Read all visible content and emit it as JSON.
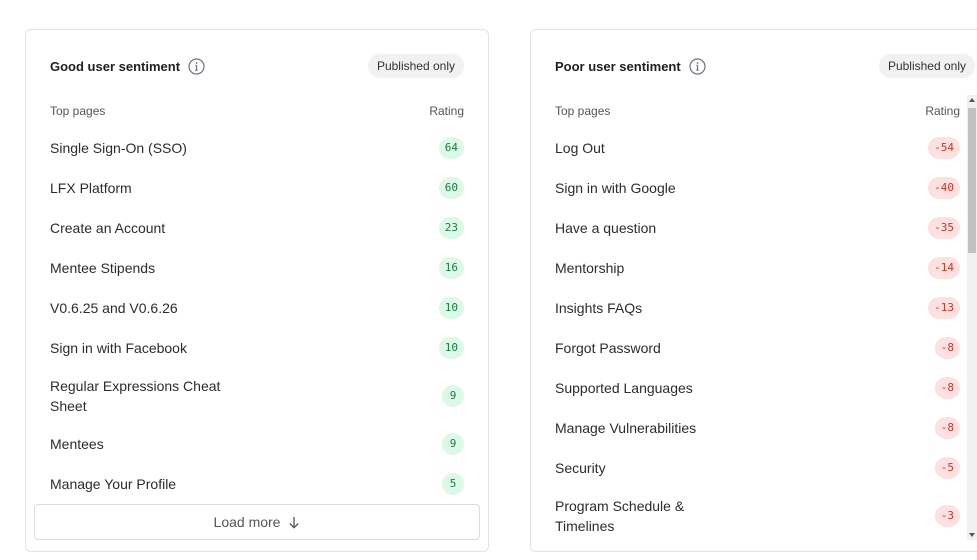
{
  "good": {
    "title": "Good user sentiment",
    "filter": "Published only",
    "col_page": "Top pages",
    "col_rating": "Rating",
    "rows": [
      {
        "label": "Single Sign-On (SSO)",
        "rating": "64"
      },
      {
        "label": "LFX Platform",
        "rating": "60"
      },
      {
        "label": "Create an Account",
        "rating": "23"
      },
      {
        "label": "Mentee Stipends",
        "rating": "16"
      },
      {
        "label": "V0.6.25 and V0.6.26",
        "rating": "10"
      },
      {
        "label": "Sign in with Facebook",
        "rating": "10"
      },
      {
        "label": "Regular Expressions Cheat Sheet",
        "rating": "9"
      },
      {
        "label": "Mentees",
        "rating": "9"
      },
      {
        "label": "Manage Your Profile",
        "rating": "5"
      }
    ],
    "load_more": "Load more"
  },
  "poor": {
    "title": "Poor user sentiment",
    "filter": "Published only",
    "col_page": "Top pages",
    "col_rating": "Rating",
    "rows": [
      {
        "label": "Log Out",
        "rating": "-54"
      },
      {
        "label": "Sign in with Google",
        "rating": "-40"
      },
      {
        "label": "Have a question",
        "rating": "-35"
      },
      {
        "label": "Mentorship",
        "rating": "-14"
      },
      {
        "label": "Insights FAQs",
        "rating": "-13"
      },
      {
        "label": "Forgot Password",
        "rating": "-8"
      },
      {
        "label": "Supported Languages",
        "rating": "-8"
      },
      {
        "label": "Manage Vulnerabilities",
        "rating": "-8"
      },
      {
        "label": "Security",
        "rating": "-5"
      },
      {
        "label": "Program Schedule & Timelines",
        "rating": "-3"
      }
    ]
  },
  "icons": {
    "info": "info-icon",
    "load_more_arrow": "arrow-down-icon"
  },
  "colors": {
    "good_badge_bg": "#dcf8e7",
    "good_badge_text": "#1f7a45",
    "poor_badge_bg": "#fde0e0",
    "poor_badge_text": "#c0392b"
  }
}
